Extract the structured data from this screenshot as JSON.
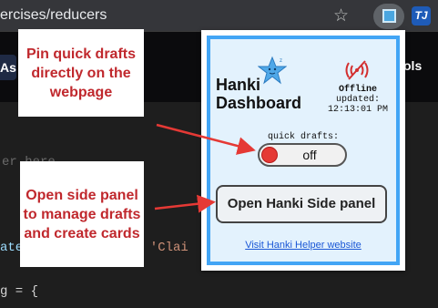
{
  "browser": {
    "url_fragment": "ercises/reducers",
    "bookmark_icon": "star-icon",
    "extensions": [
      "hanki-extension-icon",
      "tj-extension-icon"
    ],
    "tj_label": "TJ"
  },
  "site_nav": {
    "left_fragment": "As",
    "right_fragment": "ols"
  },
  "code": {
    "line1": "er here",
    "line2_var": "ate",
    "line2_rest": ", 'Clai",
    "line3": "g = {"
  },
  "callouts": {
    "pin": "Pin quick drafts directly on the webpage",
    "panel": "Open side panel to manage drafts and create cards"
  },
  "popup": {
    "brand_line1": "Hanki",
    "brand_line2": "Dashboard",
    "status": "Offline",
    "updated_label": "updated:",
    "updated_time": "12:13:01 PM",
    "quick_drafts_label": "quick drafts:",
    "toggle_state": "off",
    "side_panel_button": "Open Hanki Side panel",
    "helper_link": "Visit Hanki Helper website"
  },
  "colors": {
    "callout_text": "#c0282d",
    "arrow": "#e53935",
    "popup_border": "#42a5f5",
    "popup_bg": "#e3f2fd",
    "link": "#1a57d6"
  }
}
